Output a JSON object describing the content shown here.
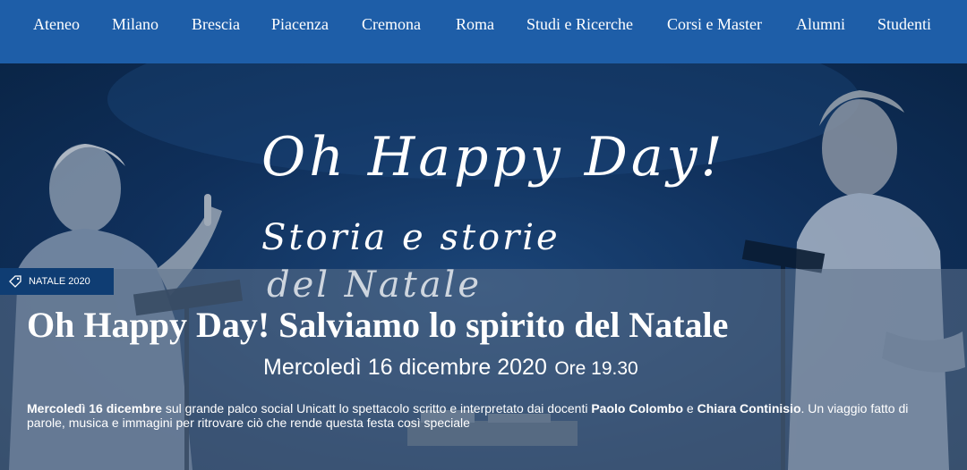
{
  "nav": {
    "items": [
      {
        "label": "Ateneo"
      },
      {
        "label": "Milano"
      },
      {
        "label": "Brescia"
      },
      {
        "label": "Piacenza"
      },
      {
        "label": "Cremona"
      },
      {
        "label": "Roma"
      },
      {
        "label": "Studi e Ricerche"
      },
      {
        "label": "Corsi e Master"
      },
      {
        "label": "Alumni"
      },
      {
        "label": "Studenti"
      }
    ]
  },
  "hero": {
    "script_title_1": "Oh Happy Day!",
    "script_title_2": "Storia e storie",
    "script_title_3": "del Natale",
    "badge": {
      "icon": "tag-icon",
      "label": "NATALE 2020"
    },
    "headline": "Oh Happy Day! Salviamo lo spirito del Natale",
    "date": "Mercoledì 16 dicembre 2020",
    "time": "Ore 19.30",
    "description": {
      "part1": "Mercoledì 16 dicembre",
      "part2": " sul grande palco social Unicatt lo spettacolo scritto e interpretato dai docenti ",
      "part3": "Paolo Colombo",
      "part4": " e ",
      "part5": "Chiara Continisio",
      "part6": ". Un viaggio fatto di parole, musica e immagini per ritrovare ciò che rende questa festa così speciale"
    }
  },
  "colors": {
    "nav_bg": "#1e5ea8",
    "badge_bg": "#0f3d73",
    "hero_bg": "#0f2f5a"
  }
}
